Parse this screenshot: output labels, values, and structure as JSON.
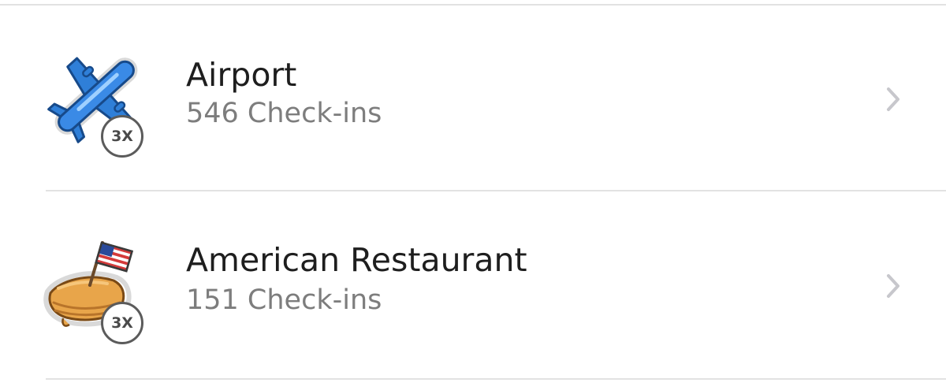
{
  "list": {
    "items": [
      {
        "title": "Airport",
        "count": "546 Check-ins",
        "badge": "3X",
        "icon": "airplane-icon"
      },
      {
        "title": "American Restaurant",
        "count": "151 Check-ins",
        "badge": "3X",
        "icon": "pie-with-flag-icon"
      }
    ]
  },
  "colors": {
    "title": "#1e1e1e",
    "subtitle": "#7d7d7d",
    "separator": "#e2e2e2",
    "chevron": "#c7c7cc",
    "airplane_blue": "#2f7fd8",
    "pie_crust": "#e8a54a"
  }
}
